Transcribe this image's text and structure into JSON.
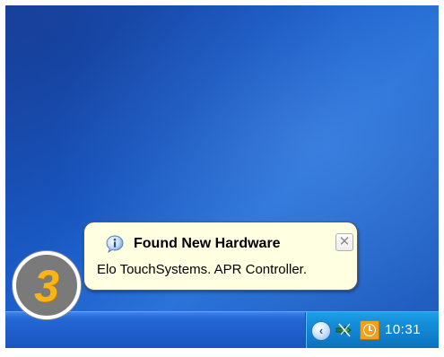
{
  "notification": {
    "title": "Found New Hardware",
    "message": "Elo TouchSystems. APR Controller.",
    "close_glyph": "✕",
    "icon": "info-icon"
  },
  "taskbar": {
    "tray": {
      "show_hidden_glyph": "‹",
      "icons": [
        "show-hidden-icons-icon",
        "safely-remove-hardware-icon",
        "clock-icon"
      ],
      "time": "10:31"
    }
  },
  "step": {
    "number": "3"
  },
  "colors": {
    "desktop": "#1a5bc7",
    "taskbar": "#1f5ecc",
    "tray": "#148ed9",
    "balloon": "#ffffe1",
    "step_number": "#f7b51b"
  }
}
